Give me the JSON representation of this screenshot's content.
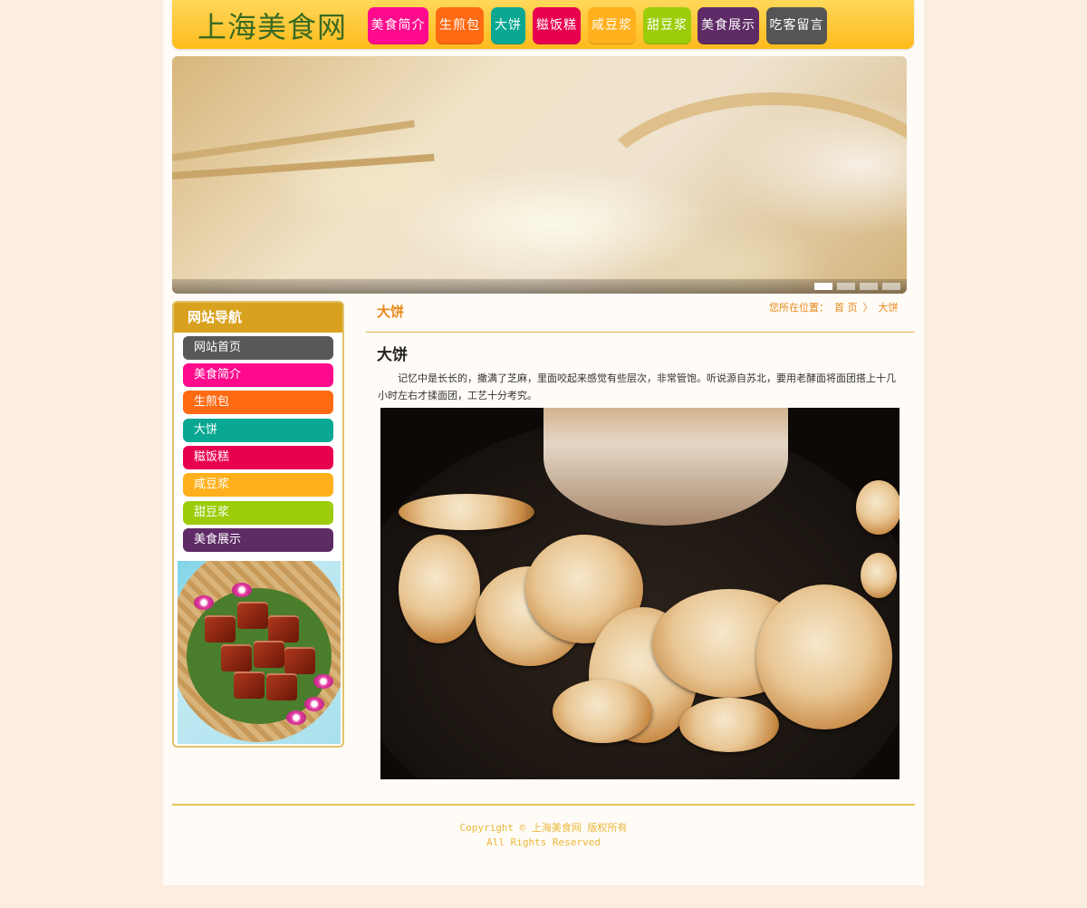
{
  "site": {
    "logo": "上海美食网"
  },
  "top_nav": [
    {
      "label": "美食简介",
      "color": "#ff0a8c"
    },
    {
      "label": "生煎包",
      "color": "#ff6a13"
    },
    {
      "label": "大饼",
      "color": "#0aa892"
    },
    {
      "label": "糍饭糕",
      "color": "#e8004f"
    },
    {
      "label": "咸豆浆",
      "color": "#ffb01c"
    },
    {
      "label": "甜豆浆",
      "color": "#9ccc0a"
    },
    {
      "label": "美食展示",
      "color": "#5e2b66"
    },
    {
      "label": "吃客留言",
      "color": "#555555"
    }
  ],
  "banner": {
    "slides": 4,
    "active_slide": 1
  },
  "sidebar": {
    "title": "网站导航",
    "items": [
      {
        "label": "网站首页",
        "color": "#585858"
      },
      {
        "label": "美食简介",
        "color": "#ff0a8c"
      },
      {
        "label": "生煎包",
        "color": "#ff6a13"
      },
      {
        "label": "大饼",
        "color": "#0aa892"
      },
      {
        "label": "糍饭糕",
        "color": "#e8004f"
      },
      {
        "label": "咸豆浆",
        "color": "#ffb01c"
      },
      {
        "label": "甜豆浆",
        "color": "#9ccc0a"
      },
      {
        "label": "美食展示",
        "color": "#5e2b66"
      }
    ]
  },
  "content": {
    "section_title": "大饼",
    "breadcrumb": {
      "prefix": "您所在位置：",
      "home": "首 页",
      "separator": "〉",
      "current": "大饼"
    },
    "article_title": "大饼",
    "article_text": "记忆中是长长的，撒满了芝麻，里面咬起来感觉有些层次，非常管饱。听说源自苏北，要用老酵面将面团搭上十几小时左右才揉面团，工艺十分考究。"
  },
  "footer": {
    "line1": "Copyright © 上海美食网 版权所有",
    "line2": "All Rights Reserved"
  },
  "colors": {
    "accent": "#e8891a",
    "header_gold": "#ffc72e",
    "sidebar_head": "#d9a21e"
  }
}
